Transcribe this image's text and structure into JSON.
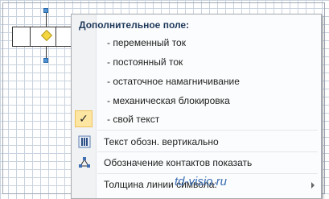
{
  "menu": {
    "header": "Дополнительное поле:",
    "items": [
      {
        "label": "- переменный ток"
      },
      {
        "label": "- постоянный ток"
      },
      {
        "label": "- остаточное намагничивание"
      },
      {
        "label": "- механическая блокировка"
      },
      {
        "label": "- свой текст",
        "checked": true,
        "check_glyph": "✓"
      }
    ],
    "actions": [
      {
        "label": "Текст обозн. вертикально",
        "icon": "vertical-text-icon"
      },
      {
        "label": "Обозначение контактов показать",
        "icon": "connection-points-icon"
      },
      {
        "label": "Толщина линии символа:",
        "has_submenu": true
      }
    ]
  },
  "watermark": "td-visio.ru",
  "colors": {
    "grid": "#c9d3df",
    "menu_header": "#1e395b",
    "check_highlight": "#fde6a1",
    "handle": "#4f95d6",
    "diamond": "#f3d640",
    "watermark": "#3c6fb5"
  }
}
